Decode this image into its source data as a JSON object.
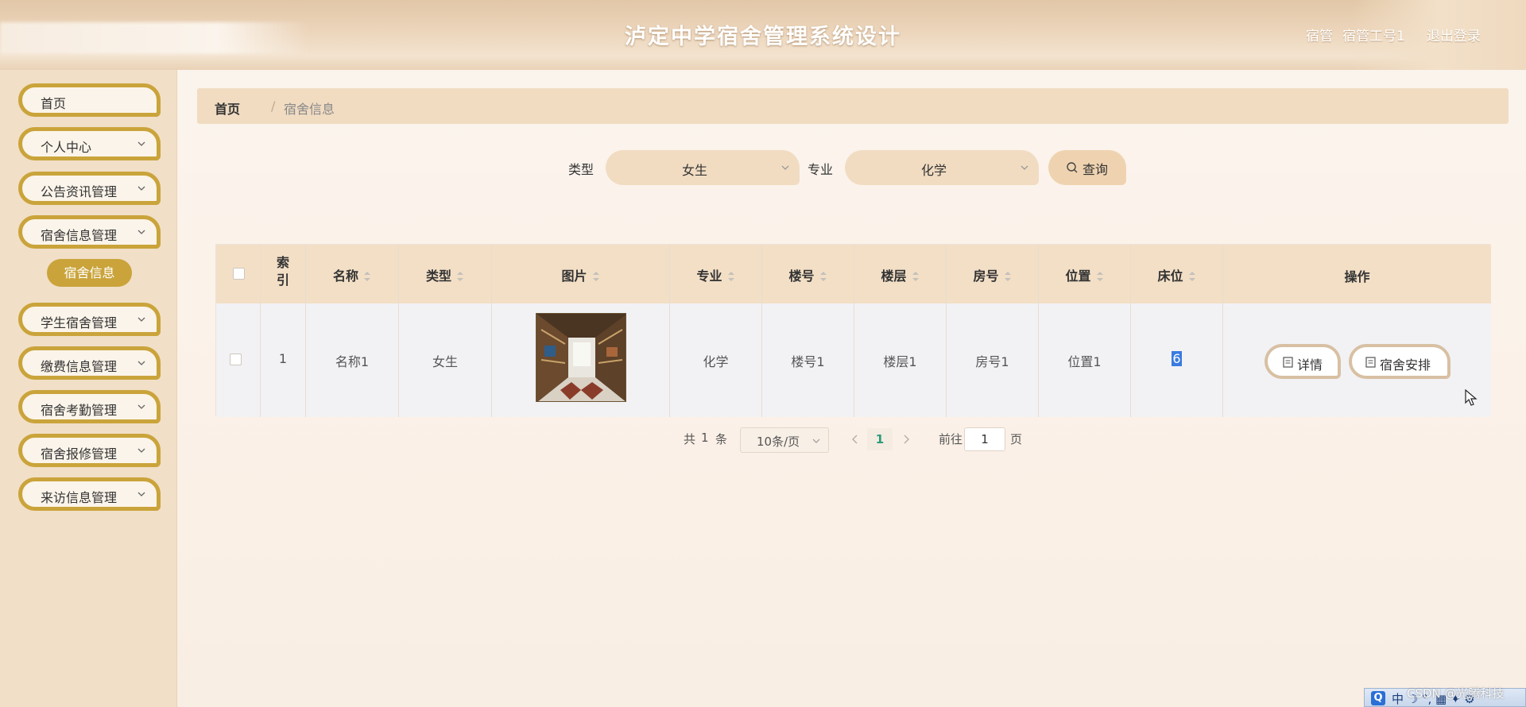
{
  "header": {
    "title": "泸定中学宿舍管理系统设计",
    "user_role": "宿管",
    "user_name": "宿管工号1",
    "logout_label": "退出登录"
  },
  "sidebar": {
    "items": [
      {
        "label": "首页",
        "has_children": false
      },
      {
        "label": "个人中心",
        "has_children": true
      },
      {
        "label": "公告资讯管理",
        "has_children": true
      },
      {
        "label": "宿舍信息管理",
        "has_children": true
      },
      {
        "label": "学生宿舍管理",
        "has_children": true
      },
      {
        "label": "缴费信息管理",
        "has_children": true
      },
      {
        "label": "宿舍考勤管理",
        "has_children": true
      },
      {
        "label": "宿舍报修管理",
        "has_children": true
      },
      {
        "label": "来访信息管理",
        "has_children": true
      }
    ],
    "active_submenu": "宿舍信息"
  },
  "breadcrumb": {
    "home": "首页",
    "separator": "/",
    "current": "宿舍信息"
  },
  "search": {
    "type_label": "类型",
    "type_value": "女生",
    "major_label": "专业",
    "major_value": "化学",
    "button_label": "查询"
  },
  "table": {
    "columns": {
      "index_top": "索",
      "index_bottom": "引",
      "name": "名称",
      "type": "类型",
      "image": "图片",
      "major": "专业",
      "building": "楼号",
      "floor": "楼层",
      "room": "房号",
      "location": "位置",
      "bed": "床位",
      "actions": "操作"
    },
    "rows": [
      {
        "index": "1",
        "name": "名称1",
        "type": "女生",
        "major": "化学",
        "building": "楼号1",
        "floor": "楼层1",
        "room": "房号1",
        "location": "位置1",
        "bed": "6"
      }
    ],
    "action_detail": "详情",
    "action_arrange": "宿舍安排"
  },
  "pagination": {
    "total_prefix": "共",
    "total": "1",
    "total_suffix": "条",
    "page_size": "10条/页",
    "current_page": "1",
    "goto_prefix": "前往",
    "goto_value": "1",
    "goto_suffix": "页"
  },
  "overlay": {
    "watermark": "CSDN @光腾科技",
    "ime_text": "中 ☽ °, ▦ ✦ ⚙"
  },
  "colors": {
    "accent": "#caa43b",
    "header": "#ecd5bb",
    "sidebar": "#f1dfc7",
    "table_header": "#f2dfc6",
    "page_active": "#2a9c7a"
  }
}
